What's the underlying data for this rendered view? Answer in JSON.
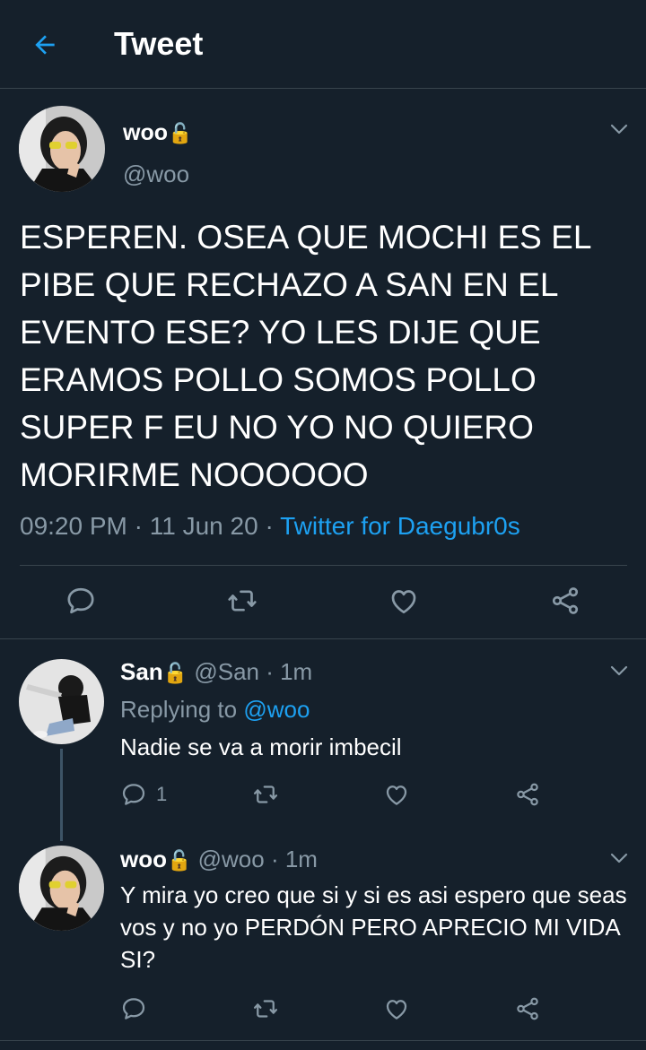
{
  "header": {
    "title": "Tweet"
  },
  "main_tweet": {
    "author_name": "woo",
    "lock_glyph": "🔓",
    "handle": "@woo",
    "text": "ESPEREN. OSEA QUE MOCHI ES EL PIBE QUE RECHAZO A SAN EN EL EVENTO ESE? YO LES DIJE QUE ERAMOS POLLO SOMOS POLLO SUPER F EU NO YO NO QUIERO MORIRME NOOOOOO",
    "time": "09:20 PM",
    "sep": "·",
    "date": "11 Jun 20",
    "source": "Twitter for Daegubr0s"
  },
  "replies": [
    {
      "author_name": "San",
      "lock_glyph": "🔓",
      "handle": "@San",
      "age": "· 1m",
      "replying_prefix": "Replying to",
      "replying_to": "@woo",
      "text": "Nadie se va a morir imbecil",
      "reply_count": "1"
    },
    {
      "author_name": "woo",
      "lock_glyph": "🔓",
      "handle": "@woo",
      "age": "· 1m",
      "text": "Y mira yo creo que si y si es asi espero que seas vos y no yo PERDÓN PERO APRECIO MI VIDA SI?"
    }
  ],
  "colors": {
    "background": "#15202b",
    "accent": "#1da1f2",
    "muted": "#8899a6",
    "divider": "#38444d"
  },
  "icons": [
    "back-arrow-icon",
    "chevron-down-icon",
    "reply-icon",
    "retweet-icon",
    "like-icon",
    "share-icon",
    "lock-icon"
  ]
}
